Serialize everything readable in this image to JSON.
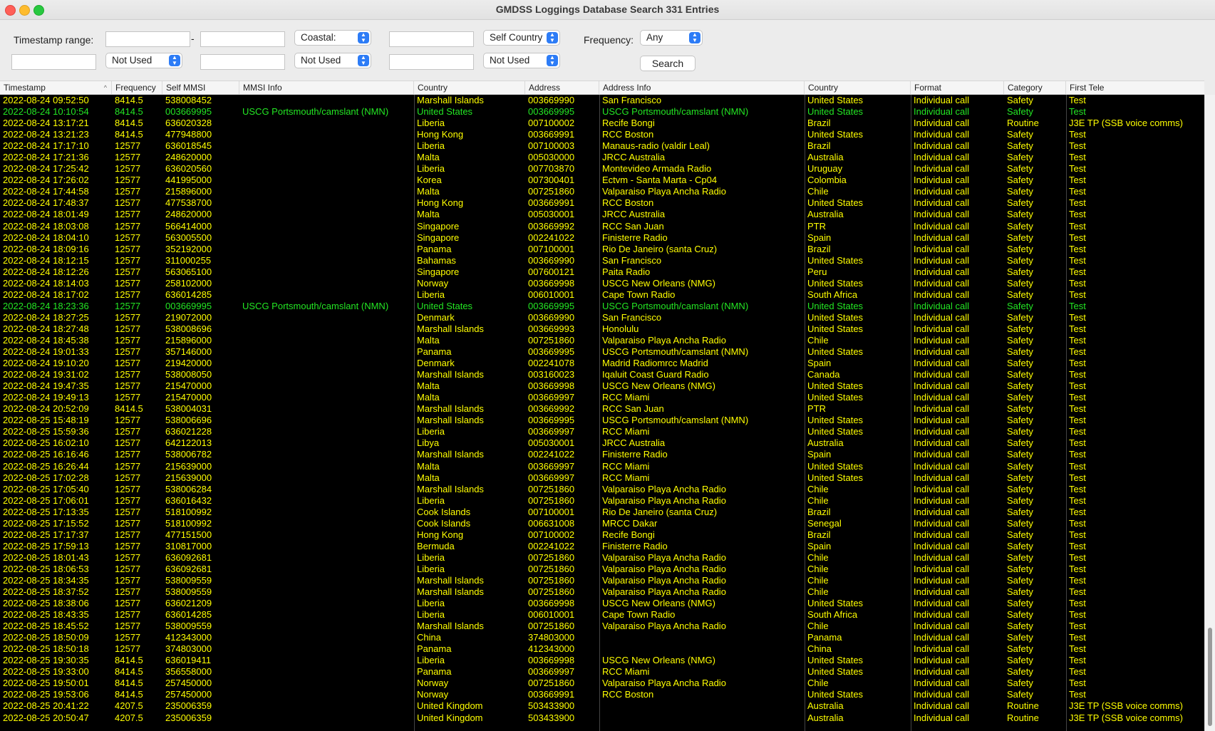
{
  "window": {
    "title": "GMDSS Loggings Database Search 331 Entries"
  },
  "filters": {
    "timestamp_label": "Timestamp range:",
    "dash": "-",
    "coastal_select": "Coastal:",
    "self_country_select": "Self Country",
    "frequency_label": "Frequency:",
    "frequency_select": "Any",
    "not_used_1": "Not Used",
    "not_used_2": "Not Used",
    "not_used_3": "Not Used",
    "search_button": "Search"
  },
  "table": {
    "columns": [
      "Timestamp",
      "Frequency",
      "Self MMSI",
      "MMSI Info",
      "Country",
      "Address",
      "Address Info",
      "Country",
      "Format",
      "Category",
      "First Tele"
    ],
    "highlight_color": "#23e623",
    "text_color": "#ffff00",
    "rows": [
      [
        "2022-08-24 09:52:50",
        "8414.5",
        "538008452",
        "",
        "Marshall Islands",
        "003669990",
        "San Francisco",
        "United States",
        "Individual call",
        "Safety",
        "Test"
      ],
      [
        "2022-08-24 10:10:54",
        "8414.5",
        "003669995",
        "USCG Portsmouth/camslant (NMN)",
        "United States",
        "003669995",
        "USCG Portsmouth/camslant (NMN)",
        "United States",
        "Individual call",
        "Safety",
        "Test"
      ],
      [
        "2022-08-24 13:17:21",
        "8414.5",
        "636020328",
        "",
        "Liberia",
        "007100002",
        "Recife Bongi",
        "Brazil",
        "Individual call",
        "Routine",
        "J3E TP (SSB voice comms)"
      ],
      [
        "2022-08-24 13:21:23",
        "8414.5",
        "477948800",
        "",
        "Hong Kong",
        "003669991",
        "RCC Boston",
        "United States",
        "Individual call",
        "Safety",
        "Test"
      ],
      [
        "2022-08-24 17:17:10",
        "12577",
        "636018545",
        "",
        "Liberia",
        "007100003",
        "Manaus-radio (valdir Leal)",
        "Brazil",
        "Individual call",
        "Safety",
        "Test"
      ],
      [
        "2022-08-24 17:21:36",
        "12577",
        "248620000",
        "",
        "Malta",
        "005030000",
        "JRCC Australia",
        "Australia",
        "Individual call",
        "Safety",
        "Test"
      ],
      [
        "2022-08-24 17:25:42",
        "12577",
        "636020560",
        "",
        "Liberia",
        "007703870",
        "Montevideo Armada Radio",
        "Uruguay",
        "Individual call",
        "Safety",
        "Test"
      ],
      [
        "2022-08-24 17:26:02",
        "12577",
        "441995000",
        "",
        "Korea",
        "007300401",
        "Ectvm - Santa Marta - Cp04",
        "Colombia",
        "Individual call",
        "Safety",
        "Test"
      ],
      [
        "2022-08-24 17:44:58",
        "12577",
        "215896000",
        "",
        "Malta",
        "007251860",
        "Valparaiso Playa Ancha Radio",
        "Chile",
        "Individual call",
        "Safety",
        "Test"
      ],
      [
        "2022-08-24 17:48:37",
        "12577",
        "477538700",
        "",
        "Hong Kong",
        "003669991",
        "RCC Boston",
        "United States",
        "Individual call",
        "Safety",
        "Test"
      ],
      [
        "2022-08-24 18:01:49",
        "12577",
        "248620000",
        "",
        "Malta",
        "005030001",
        "JRCC Australia",
        "Australia",
        "Individual call",
        "Safety",
        "Test"
      ],
      [
        "2022-08-24 18:03:08",
        "12577",
        "566414000",
        "",
        "Singapore",
        "003669992",
        "RCC San Juan",
        "PTR",
        "Individual call",
        "Safety",
        "Test"
      ],
      [
        "2022-08-24 18:04:10",
        "12577",
        "563005500",
        "",
        "Singapore",
        "002241022",
        "Finisterre Radio",
        "Spain",
        "Individual call",
        "Safety",
        "Test"
      ],
      [
        "2022-08-24 18:09:16",
        "12577",
        "352192000",
        "",
        "Panama",
        "007100001",
        "Rio De Janeiro (santa Cruz)",
        "Brazil",
        "Individual call",
        "Safety",
        "Test"
      ],
      [
        "2022-08-24 18:12:15",
        "12577",
        "311000255",
        "",
        "Bahamas",
        "003669990",
        "San Francisco",
        "United States",
        "Individual call",
        "Safety",
        "Test"
      ],
      [
        "2022-08-24 18:12:26",
        "12577",
        "563065100",
        "",
        "Singapore",
        "007600121",
        "Paita Radio",
        "Peru",
        "Individual call",
        "Safety",
        "Test"
      ],
      [
        "2022-08-24 18:14:03",
        "12577",
        "258102000",
        "",
        "Norway",
        "003669998",
        "USCG New Orleans (NMG)",
        "United States",
        "Individual call",
        "Safety",
        "Test"
      ],
      [
        "2022-08-24 18:17:02",
        "12577",
        "636014285",
        "",
        "Liberia",
        "006010001",
        "Cape Town Radio",
        "South Africa",
        "Individual call",
        "Safety",
        "Test"
      ],
      [
        "2022-08-24 18:23:36",
        "12577",
        "003669995",
        "USCG Portsmouth/camslant (NMN)",
        "United States",
        "003669995",
        "USCG Portsmouth/camslant (NMN)",
        "United States",
        "Individual call",
        "Safety",
        "Test"
      ],
      [
        "2022-08-24 18:27:25",
        "12577",
        "219072000",
        "",
        "Denmark",
        "003669990",
        "San Francisco",
        "United States",
        "Individual call",
        "Safety",
        "Test"
      ],
      [
        "2022-08-24 18:27:48",
        "12577",
        "538008696",
        "",
        "Marshall Islands",
        "003669993",
        "Honolulu",
        "United States",
        "Individual call",
        "Safety",
        "Test"
      ],
      [
        "2022-08-24 18:45:38",
        "12577",
        "215896000",
        "",
        "Malta",
        "007251860",
        "Valparaiso Playa Ancha Radio",
        "Chile",
        "Individual call",
        "Safety",
        "Test"
      ],
      [
        "2022-08-24 19:01:33",
        "12577",
        "357146000",
        "",
        "Panama",
        "003669995",
        "USCG Portsmouth/camslant (NMN)",
        "United States",
        "Individual call",
        "Safety",
        "Test"
      ],
      [
        "2022-08-24 19:10:20",
        "12577",
        "219420000",
        "",
        "Denmark",
        "002241078",
        "Madrid Radiomrcc Madrid",
        "Spain",
        "Individual call",
        "Safety",
        "Test"
      ],
      [
        "2022-08-24 19:31:02",
        "12577",
        "538008050",
        "",
        "Marshall Islands",
        "003160023",
        "Iqaluit Coast Guard Radio",
        "Canada",
        "Individual call",
        "Safety",
        "Test"
      ],
      [
        "2022-08-24 19:47:35",
        "12577",
        "215470000",
        "",
        "Malta",
        "003669998",
        "USCG New Orleans (NMG)",
        "United States",
        "Individual call",
        "Safety",
        "Test"
      ],
      [
        "2022-08-24 19:49:13",
        "12577",
        "215470000",
        "",
        "Malta",
        "003669997",
        "RCC Miami",
        "United States",
        "Individual call",
        "Safety",
        "Test"
      ],
      [
        "2022-08-24 20:52:09",
        "8414.5",
        "538004031",
        "",
        "Marshall Islands",
        "003669992",
        "RCC San Juan",
        "PTR",
        "Individual call",
        "Safety",
        "Test"
      ],
      [
        "2022-08-25 15:48:19",
        "12577",
        "538006696",
        "",
        "Marshall Islands",
        "003669995",
        "USCG Portsmouth/camslant (NMN)",
        "United States",
        "Individual call",
        "Safety",
        "Test"
      ],
      [
        "2022-08-25 15:59:36",
        "12577",
        "636021228",
        "",
        "Liberia",
        "003669997",
        "RCC Miami",
        "United States",
        "Individual call",
        "Safety",
        "Test"
      ],
      [
        "2022-08-25 16:02:10",
        "12577",
        "642122013",
        "",
        "Libya",
        "005030001",
        "JRCC Australia",
        "Australia",
        "Individual call",
        "Safety",
        "Test"
      ],
      [
        "2022-08-25 16:16:46",
        "12577",
        "538006782",
        "",
        "Marshall Islands",
        "002241022",
        "Finisterre Radio",
        "Spain",
        "Individual call",
        "Safety",
        "Test"
      ],
      [
        "2022-08-25 16:26:44",
        "12577",
        "215639000",
        "",
        "Malta",
        "003669997",
        "RCC Miami",
        "United States",
        "Individual call",
        "Safety",
        "Test"
      ],
      [
        "2022-08-25 17:02:28",
        "12577",
        "215639000",
        "",
        "Malta",
        "003669997",
        "RCC Miami",
        "United States",
        "Individual call",
        "Safety",
        "Test"
      ],
      [
        "2022-08-25 17:05:40",
        "12577",
        "538006284",
        "",
        "Marshall Islands",
        "007251860",
        "Valparaiso Playa Ancha Radio",
        "Chile",
        "Individual call",
        "Safety",
        "Test"
      ],
      [
        "2022-08-25 17:06:01",
        "12577",
        "636016432",
        "",
        "Liberia",
        "007251860",
        "Valparaiso Playa Ancha Radio",
        "Chile",
        "Individual call",
        "Safety",
        "Test"
      ],
      [
        "2022-08-25 17:13:35",
        "12577",
        "518100992",
        "",
        "Cook Islands",
        "007100001",
        "Rio De Janeiro (santa Cruz)",
        "Brazil",
        "Individual call",
        "Safety",
        "Test"
      ],
      [
        "2022-08-25 17:15:52",
        "12577",
        "518100992",
        "",
        "Cook Islands",
        "006631008",
        "MRCC Dakar",
        "Senegal",
        "Individual call",
        "Safety",
        "Test"
      ],
      [
        "2022-08-25 17:17:37",
        "12577",
        "477151500",
        "",
        "Hong Kong",
        "007100002",
        "Recife Bongi",
        "Brazil",
        "Individual call",
        "Safety",
        "Test"
      ],
      [
        "2022-08-25 17:59:13",
        "12577",
        "310817000",
        "",
        "Bermuda",
        "002241022",
        "Finisterre Radio",
        "Spain",
        "Individual call",
        "Safety",
        "Test"
      ],
      [
        "2022-08-25 18:01:43",
        "12577",
        "636092681",
        "",
        "Liberia",
        "007251860",
        "Valparaiso Playa Ancha Radio",
        "Chile",
        "Individual call",
        "Safety",
        "Test"
      ],
      [
        "2022-08-25 18:06:53",
        "12577",
        "636092681",
        "",
        "Liberia",
        "007251860",
        "Valparaiso Playa Ancha Radio",
        "Chile",
        "Individual call",
        "Safety",
        "Test"
      ],
      [
        "2022-08-25 18:34:35",
        "12577",
        "538009559",
        "",
        "Marshall Islands",
        "007251860",
        "Valparaiso Playa Ancha Radio",
        "Chile",
        "Individual call",
        "Safety",
        "Test"
      ],
      [
        "2022-08-25 18:37:52",
        "12577",
        "538009559",
        "",
        "Marshall Islands",
        "007251860",
        "Valparaiso Playa Ancha Radio",
        "Chile",
        "Individual call",
        "Safety",
        "Test"
      ],
      [
        "2022-08-25 18:38:06",
        "12577",
        "636021209",
        "",
        "Liberia",
        "003669998",
        "USCG New Orleans (NMG)",
        "United States",
        "Individual call",
        "Safety",
        "Test"
      ],
      [
        "2022-08-25 18:43:35",
        "12577",
        "636014285",
        "",
        "Liberia",
        "006010001",
        "Cape Town Radio",
        "South Africa",
        "Individual call",
        "Safety",
        "Test"
      ],
      [
        "2022-08-25 18:45:52",
        "12577",
        "538009559",
        "",
        "Marshall Islands",
        "007251860",
        "Valparaiso Playa Ancha Radio",
        "Chile",
        "Individual call",
        "Safety",
        "Test"
      ],
      [
        "2022-08-25 18:50:09",
        "12577",
        "412343000",
        "",
        "China",
        "374803000",
        "",
        "Panama",
        "Individual call",
        "Safety",
        "Test"
      ],
      [
        "2022-08-25 18:50:18",
        "12577",
        "374803000",
        "",
        "Panama",
        "412343000",
        "",
        "China",
        "Individual call",
        "Safety",
        "Test"
      ],
      [
        "2022-08-25 19:30:35",
        "8414.5",
        "636019411",
        "",
        "Liberia",
        "003669998",
        "USCG New Orleans (NMG)",
        "United States",
        "Individual call",
        "Safety",
        "Test"
      ],
      [
        "2022-08-25 19:33:00",
        "8414.5",
        "356558000",
        "",
        "Panama",
        "003669997",
        "RCC Miami",
        "United States",
        "Individual call",
        "Safety",
        "Test"
      ],
      [
        "2022-08-25 19:50:01",
        "8414.5",
        "257450000",
        "",
        "Norway",
        "007251860",
        "Valparaiso Playa Ancha Radio",
        "Chile",
        "Individual call",
        "Safety",
        "Test"
      ],
      [
        "2022-08-25 19:53:06",
        "8414.5",
        "257450000",
        "",
        "Norway",
        "003669991",
        "RCC Boston",
        "United States",
        "Individual call",
        "Safety",
        "Test"
      ],
      [
        "2022-08-25 20:41:22",
        "4207.5",
        "235006359",
        "",
        "United Kingdom",
        "503433900",
        "",
        "Australia",
        "Individual call",
        "Routine",
        "J3E TP (SSB voice comms)"
      ],
      [
        "2022-08-25 20:50:47",
        "4207.5",
        "235006359",
        "",
        "United Kingdom",
        "503433900",
        "",
        "Australia",
        "Individual call",
        "Routine",
        "J3E TP (SSB voice comms)"
      ]
    ],
    "highlighted_rows": [
      1,
      18
    ]
  }
}
